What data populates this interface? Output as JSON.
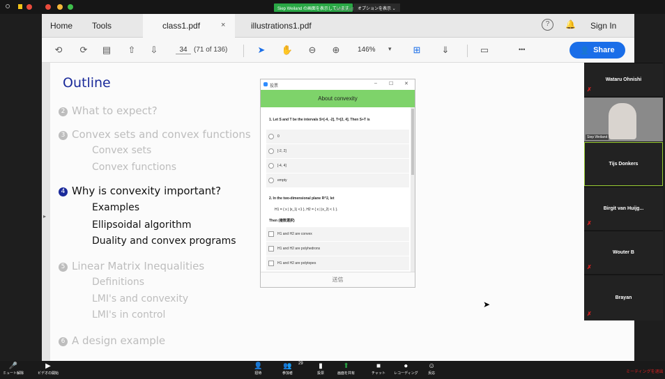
{
  "zoom": {
    "share_banner": "Siep Weiland の画面を表示しています",
    "options_label": "オプションを表示 ⌄",
    "top_doc": "class1.pdf"
  },
  "app": {
    "tabs": [
      "Home",
      "Tools",
      "class1.pdf",
      "illustrations1.pdf"
    ],
    "close_glyph": "×",
    "help": "?",
    "sign_in": "Sign In"
  },
  "toolbar": {
    "page_current": "34",
    "page_total": "(71 of 136)",
    "zoom": "146%",
    "more": "•••",
    "share": "Share"
  },
  "outline": {
    "title": "Outline",
    "items": [
      {
        "num": "2",
        "text": "What to expect?"
      },
      {
        "num": "3",
        "text": "Convex sets and convex functions"
      },
      {
        "num": "",
        "text": "Convex sets"
      },
      {
        "num": "",
        "text": "Convex functions"
      },
      {
        "num": "4",
        "text": "Why is convexity important?"
      },
      {
        "num": "",
        "text": "Examples"
      },
      {
        "num": "",
        "text": "Ellipsoidal algorithm"
      },
      {
        "num": "",
        "text": "Duality and convex programs"
      },
      {
        "num": "5",
        "text": "Linear Matrix Inequalities"
      },
      {
        "num": "",
        "text": "Definitions"
      },
      {
        "num": "",
        "text": "LMI's and convexity"
      },
      {
        "num": "",
        "text": "LMI's in control"
      },
      {
        "num": "6",
        "text": "A design example"
      }
    ]
  },
  "dialog": {
    "window_title": "投票",
    "header": "About convexity",
    "q1": "1. Let S and T be the intervals S=[-4, -2],  T=[2, 4]. Then S+T is",
    "q1_options": [
      "0",
      "[-2, 2]",
      "[-4, 4]",
      "empty"
    ],
    "q2": "2. In the two-dimensional plane R^2, let",
    "q2_sets": "H1 = { x  |   |x_1| <1 },     H2 = { x  |  |x_2| < 1 }.",
    "q2_then": "Then (複数選択)",
    "q2_options": [
      "H1 and H2 are convex",
      "H1 and H2 are polyhedrons",
      "H1 and H2 are polytopes"
    ],
    "submit": "送信"
  },
  "participants": [
    "Wataru Ohnishi",
    "Siep Weiland",
    "Tijs Donkers",
    "Birgit van Huijg...",
    "Wouter B",
    "Brayan"
  ],
  "bottom": {
    "left": [
      "ミュート解除",
      "ビデオの開始"
    ],
    "center": [
      "招待",
      "参加者",
      "投票",
      "画面を共有",
      "チャット",
      "レコーディング",
      "反応"
    ],
    "participant_count": "29",
    "leave": "ミーティングを退出"
  }
}
